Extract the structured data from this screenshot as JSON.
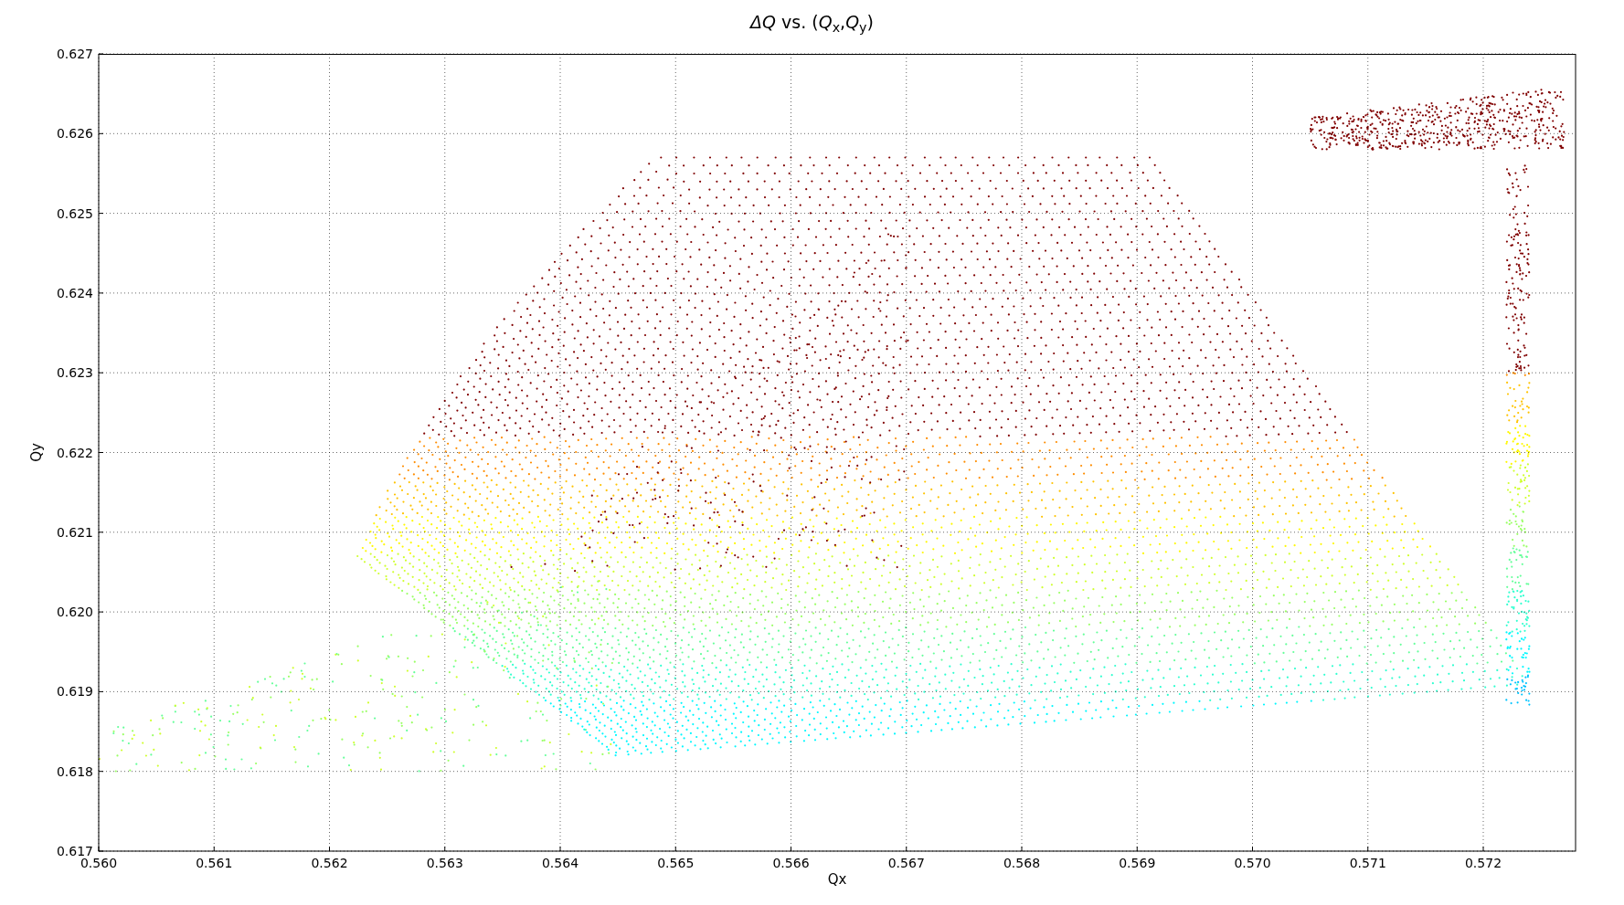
{
  "chart_data": {
    "type": "scatter",
    "grid": true,
    "title": "*ΔQ* vs. (*Q*$_{x}$,*Q*$_{y}$)",
    "xlabel": "Qx",
    "ylabel": "Qy",
    "xlim": [
      0.56,
      0.5728
    ],
    "ylim": [
      0.617,
      0.627
    ],
    "xticks": [
      {
        "value": 0.56,
        "label": "0.560"
      },
      {
        "value": 0.561,
        "label": "0.561"
      },
      {
        "value": 0.562,
        "label": "0.562"
      },
      {
        "value": 0.563,
        "label": "0.563"
      },
      {
        "value": 0.564,
        "label": "0.564"
      },
      {
        "value": 0.565,
        "label": "0.565"
      },
      {
        "value": 0.566,
        "label": "0.566"
      },
      {
        "value": 0.567,
        "label": "0.567"
      },
      {
        "value": 0.568,
        "label": "0.568"
      },
      {
        "value": 0.569,
        "label": "0.569"
      },
      {
        "value": 0.57,
        "label": "0.570"
      },
      {
        "value": 0.571,
        "label": "0.571"
      },
      {
        "value": 0.572,
        "label": "0.572"
      }
    ],
    "yticks": [
      {
        "value": 0.617,
        "label": "0.617"
      },
      {
        "value": 0.618,
        "label": "0.618"
      },
      {
        "value": 0.619,
        "label": "0.619"
      },
      {
        "value": 0.62,
        "label": "0.620"
      },
      {
        "value": 0.621,
        "label": "0.621"
      },
      {
        "value": 0.622,
        "label": "0.622"
      },
      {
        "value": 0.623,
        "label": "0.623"
      },
      {
        "value": 0.624,
        "label": "0.624"
      },
      {
        "value": 0.625,
        "label": "0.625"
      },
      {
        "value": 0.626,
        "label": "0.626"
      },
      {
        "value": 0.627,
        "label": "0.627"
      }
    ]
  }
}
